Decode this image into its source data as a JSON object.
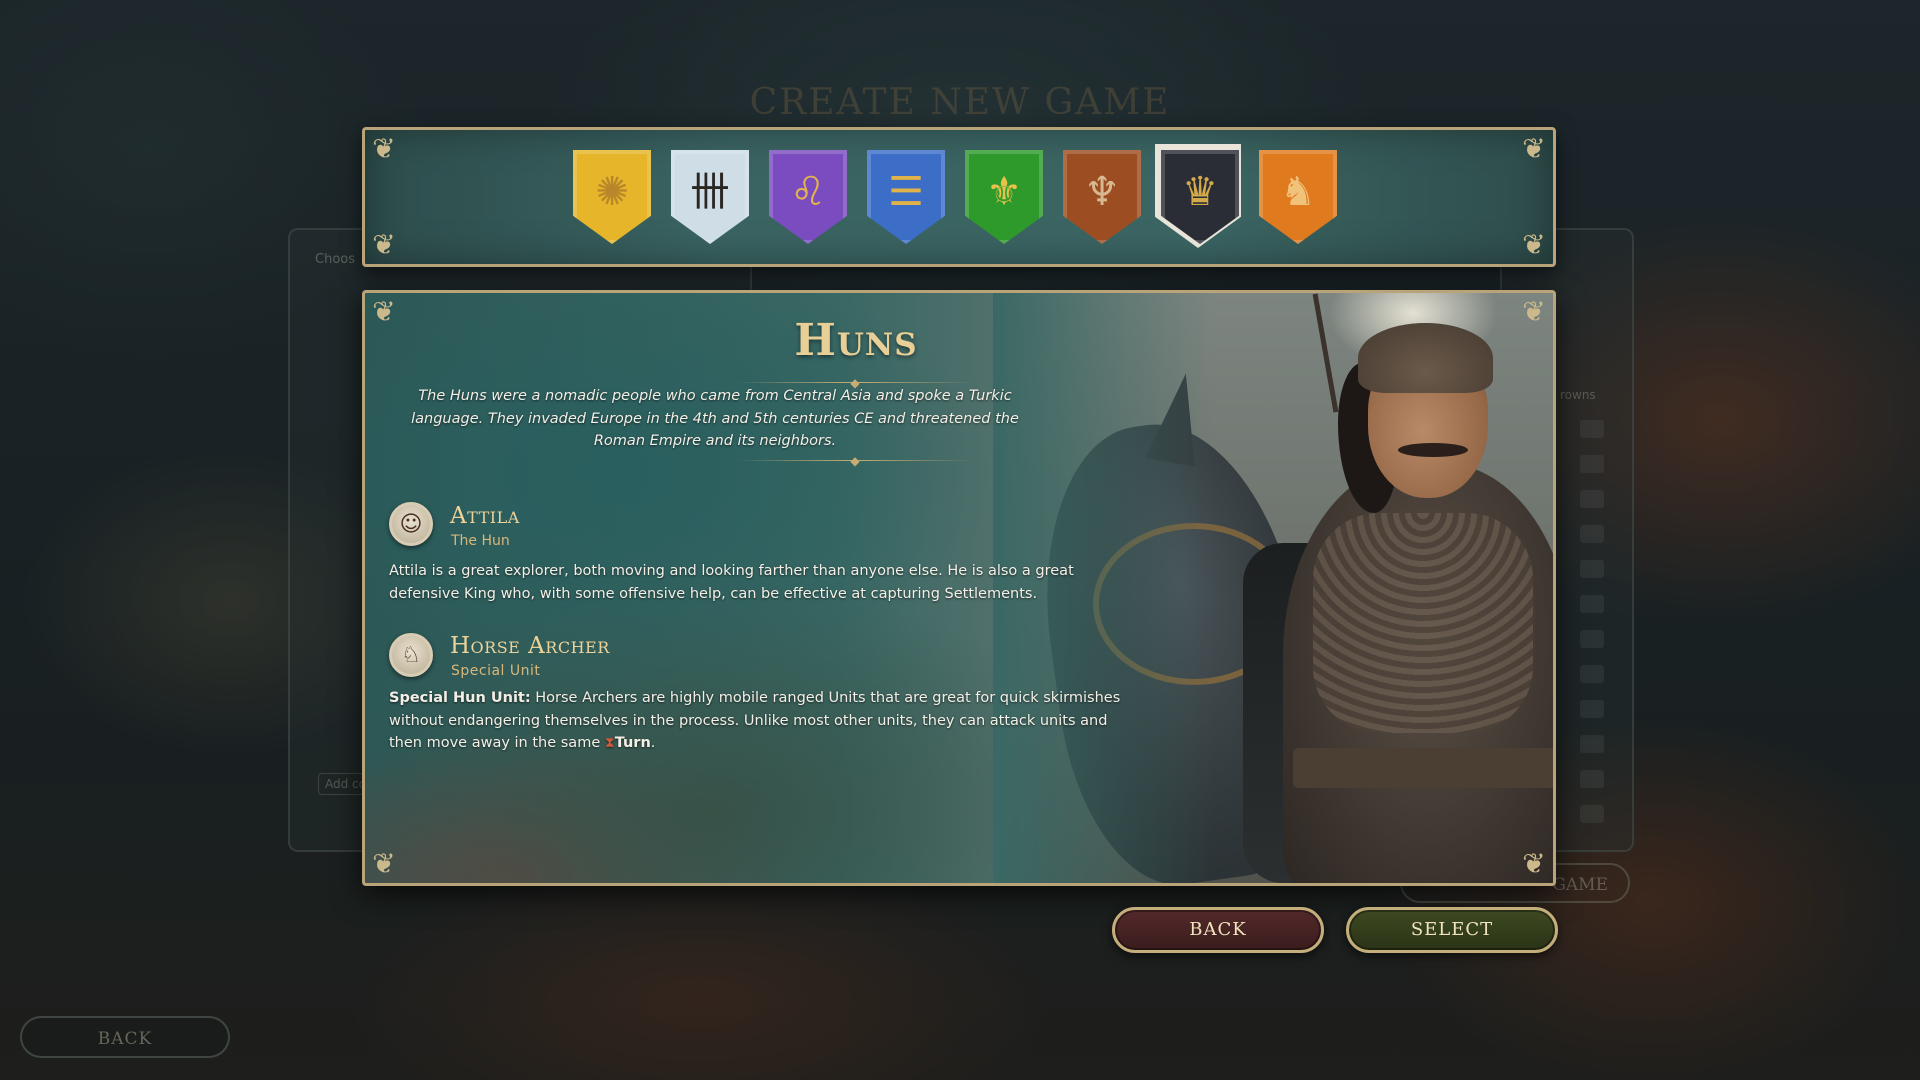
{
  "background": {
    "title": "CREATE NEW GAME",
    "choose_label": "Choos",
    "add_label": "Add co",
    "crowns_label": "rowns",
    "game_button": "GAME",
    "back_button": "BACK"
  },
  "crests": [
    {
      "name": "sun-crest",
      "color": "#e6b52a",
      "glyph": "✺",
      "glyph_color": "#b8872a",
      "selected": false
    },
    {
      "name": "rune-crest",
      "color": "#cfdde6",
      "glyph": "卌",
      "glyph_color": "#2a2622",
      "selected": false
    },
    {
      "name": "lion-crest",
      "color": "#7b4cc0",
      "glyph": "♌",
      "glyph_color": "#e2b34d",
      "selected": false
    },
    {
      "name": "three-lions-crest",
      "color": "#3c6ec8",
      "glyph": "☰",
      "glyph_color": "#e0b24a",
      "selected": false
    },
    {
      "name": "fleur-de-lis-crest",
      "color": "#2e9a2b",
      "glyph": "⚜",
      "glyph_color": "#e7c24a",
      "selected": false
    },
    {
      "name": "eagle-crest",
      "color": "#9c4e22",
      "glyph": "♆",
      "glyph_color": "#d8b890",
      "selected": false
    },
    {
      "name": "double-eagle-crest",
      "color": "#2a2d35",
      "glyph": "♛",
      "glyph_color": "#d4a94a",
      "selected": true
    },
    {
      "name": "griffin-crest",
      "color": "#e07a1e",
      "glyph": "♞",
      "glyph_color": "#f1c27a",
      "selected": false
    }
  ],
  "faction": {
    "name": "Huns",
    "description": "The Huns were a nomadic people who came from Central Asia and spoke a Turkic language. They invaded Europe in the 4th and 5th centuries CE and threatened the Roman Empire and its neighbors."
  },
  "leader": {
    "name": "Attila",
    "title": "The Hun",
    "description": "Attila is a great explorer, both moving and looking farther than anyone else. He is also a great defensive King who, with some offensive help, can be effective at capturing Settlements."
  },
  "unit": {
    "name": "Horse Archer",
    "title": "Special Unit",
    "bold_prefix": "Special Hun Unit:",
    "description": " Horse Archers are highly mobile ranged Units that are great for quick skirmishes without endangering themselves in the process. Unlike most other units, they can attack units and then move away in the same ",
    "turn_label": "Turn",
    "end": "."
  },
  "buttons": {
    "back": "BACK",
    "select": "SELECT"
  }
}
